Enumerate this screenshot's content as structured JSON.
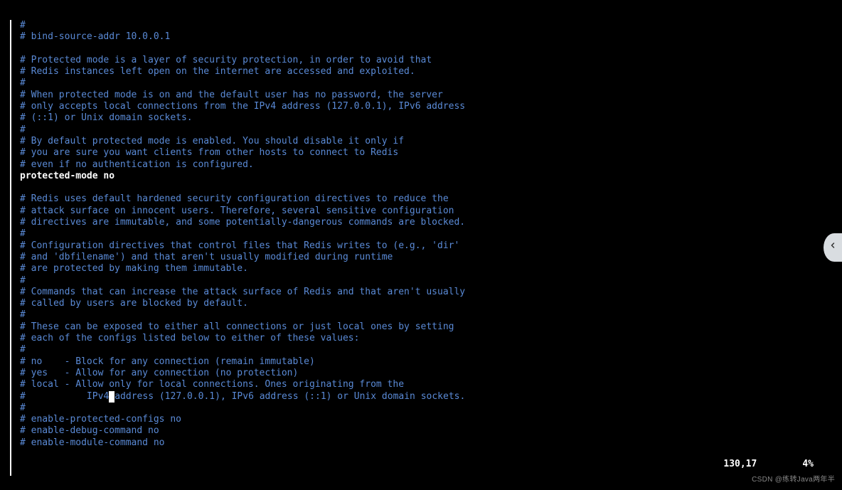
{
  "lines": [
    {
      "style": "comment",
      "text": "#"
    },
    {
      "style": "comment",
      "text": "# bind-source-addr 10.0.0.1"
    },
    {
      "style": "comment",
      "text": ""
    },
    {
      "style": "comment",
      "text": "# Protected mode is a layer of security protection, in order to avoid that"
    },
    {
      "style": "comment",
      "text": "# Redis instances left open on the internet are accessed and exploited."
    },
    {
      "style": "comment",
      "text": "#"
    },
    {
      "style": "comment",
      "text": "# When protected mode is on and the default user has no password, the server"
    },
    {
      "style": "comment",
      "text": "# only accepts local connections from the IPv4 address (127.0.0.1), IPv6 address"
    },
    {
      "style": "comment",
      "text": "# (::1) or Unix domain sockets."
    },
    {
      "style": "comment",
      "text": "#"
    },
    {
      "style": "comment",
      "text": "# By default protected mode is enabled. You should disable it only if"
    },
    {
      "style": "comment",
      "text": "# you are sure you want clients from other hosts to connect to Redis"
    },
    {
      "style": "comment",
      "text": "# even if no authentication is configured."
    },
    {
      "style": "plain",
      "text": "protected-mode no"
    },
    {
      "style": "comment",
      "text": ""
    },
    {
      "style": "comment",
      "text": "# Redis uses default hardened security configuration directives to reduce the"
    },
    {
      "style": "comment",
      "text": "# attack surface on innocent users. Therefore, several sensitive configuration"
    },
    {
      "style": "comment",
      "text": "# directives are immutable, and some potentially-dangerous commands are blocked."
    },
    {
      "style": "comment",
      "text": "#"
    },
    {
      "style": "comment",
      "text": "# Configuration directives that control files that Redis writes to (e.g., 'dir'"
    },
    {
      "style": "comment",
      "text": "# and 'dbfilename') and that aren't usually modified during runtime"
    },
    {
      "style": "comment",
      "text": "# are protected by making them immutable."
    },
    {
      "style": "comment",
      "text": "#"
    },
    {
      "style": "comment",
      "text": "# Commands that can increase the attack surface of Redis and that aren't usually"
    },
    {
      "style": "comment",
      "text": "# called by users are blocked by default."
    },
    {
      "style": "comment",
      "text": "#"
    },
    {
      "style": "comment",
      "text": "# These can be exposed to either all connections or just local ones by setting"
    },
    {
      "style": "comment",
      "text": "# each of the configs listed below to either of these values:"
    },
    {
      "style": "comment",
      "text": "#"
    },
    {
      "style": "comment",
      "text": "# no    - Block for any connection (remain immutable)"
    },
    {
      "style": "comment",
      "text": "# yes   - Allow for any connection (no protection)"
    },
    {
      "style": "comment",
      "text": "# local - Allow only for local connections. Ones originating from the"
    },
    {
      "style": "comment",
      "cursorAt": 16,
      "text": "#           IPv4 address (127.0.0.1), IPv6 address (::1) or Unix domain sockets."
    },
    {
      "style": "comment",
      "text": "#"
    },
    {
      "style": "comment",
      "text": "# enable-protected-configs no"
    },
    {
      "style": "comment",
      "text": "# enable-debug-command no"
    },
    {
      "style": "comment",
      "text": "# enable-module-command no"
    }
  ],
  "status": {
    "position": "130,17",
    "percent": "4%"
  },
  "watermark": "CSDN @练转Java两年半"
}
